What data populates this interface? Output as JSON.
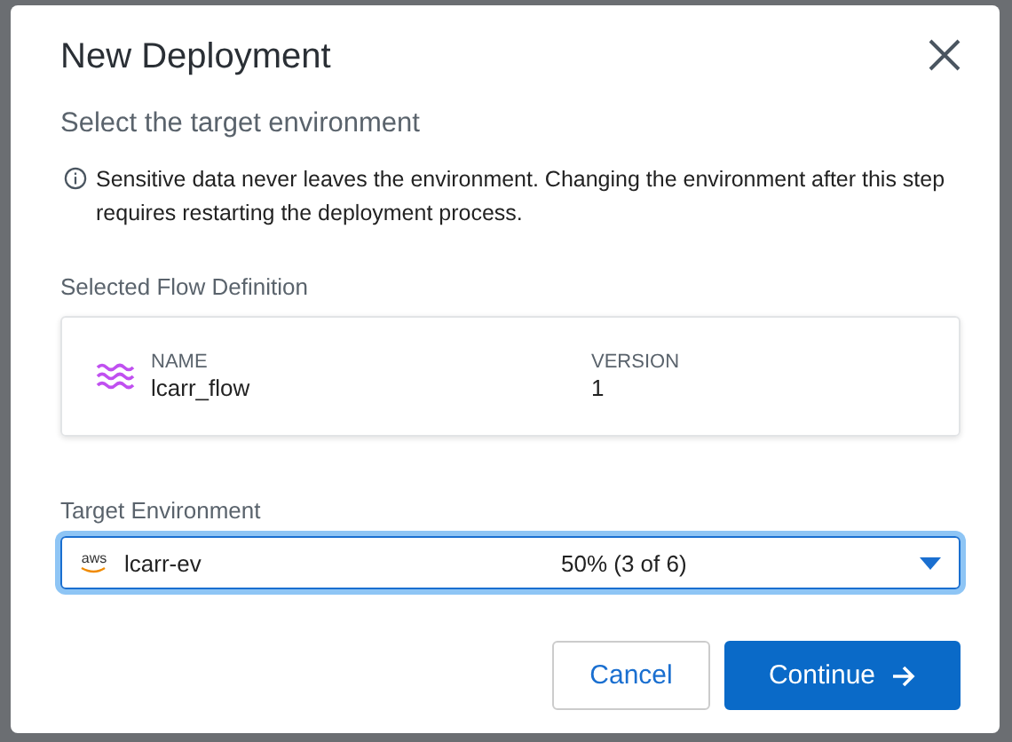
{
  "dialog": {
    "title": "New Deployment",
    "subtitle": "Select the target environment",
    "notice": "Sensitive data never leaves the environment. Changing the environment after this step requires restarting the deployment process."
  },
  "flow_definition": {
    "label": "Selected Flow Definition",
    "name_label": "NAME",
    "name": "lcarr_flow",
    "version_label": "VERSION",
    "version": "1"
  },
  "target_environment": {
    "label": "Target Environment",
    "provider": "aws",
    "value": "lcarr-ev",
    "usage": "50% (3 of 6)",
    "focused": true
  },
  "buttons": [
    {
      "label": "Cancel",
      "kind": "secondary"
    },
    {
      "label": "Continue",
      "kind": "primary"
    }
  ]
}
